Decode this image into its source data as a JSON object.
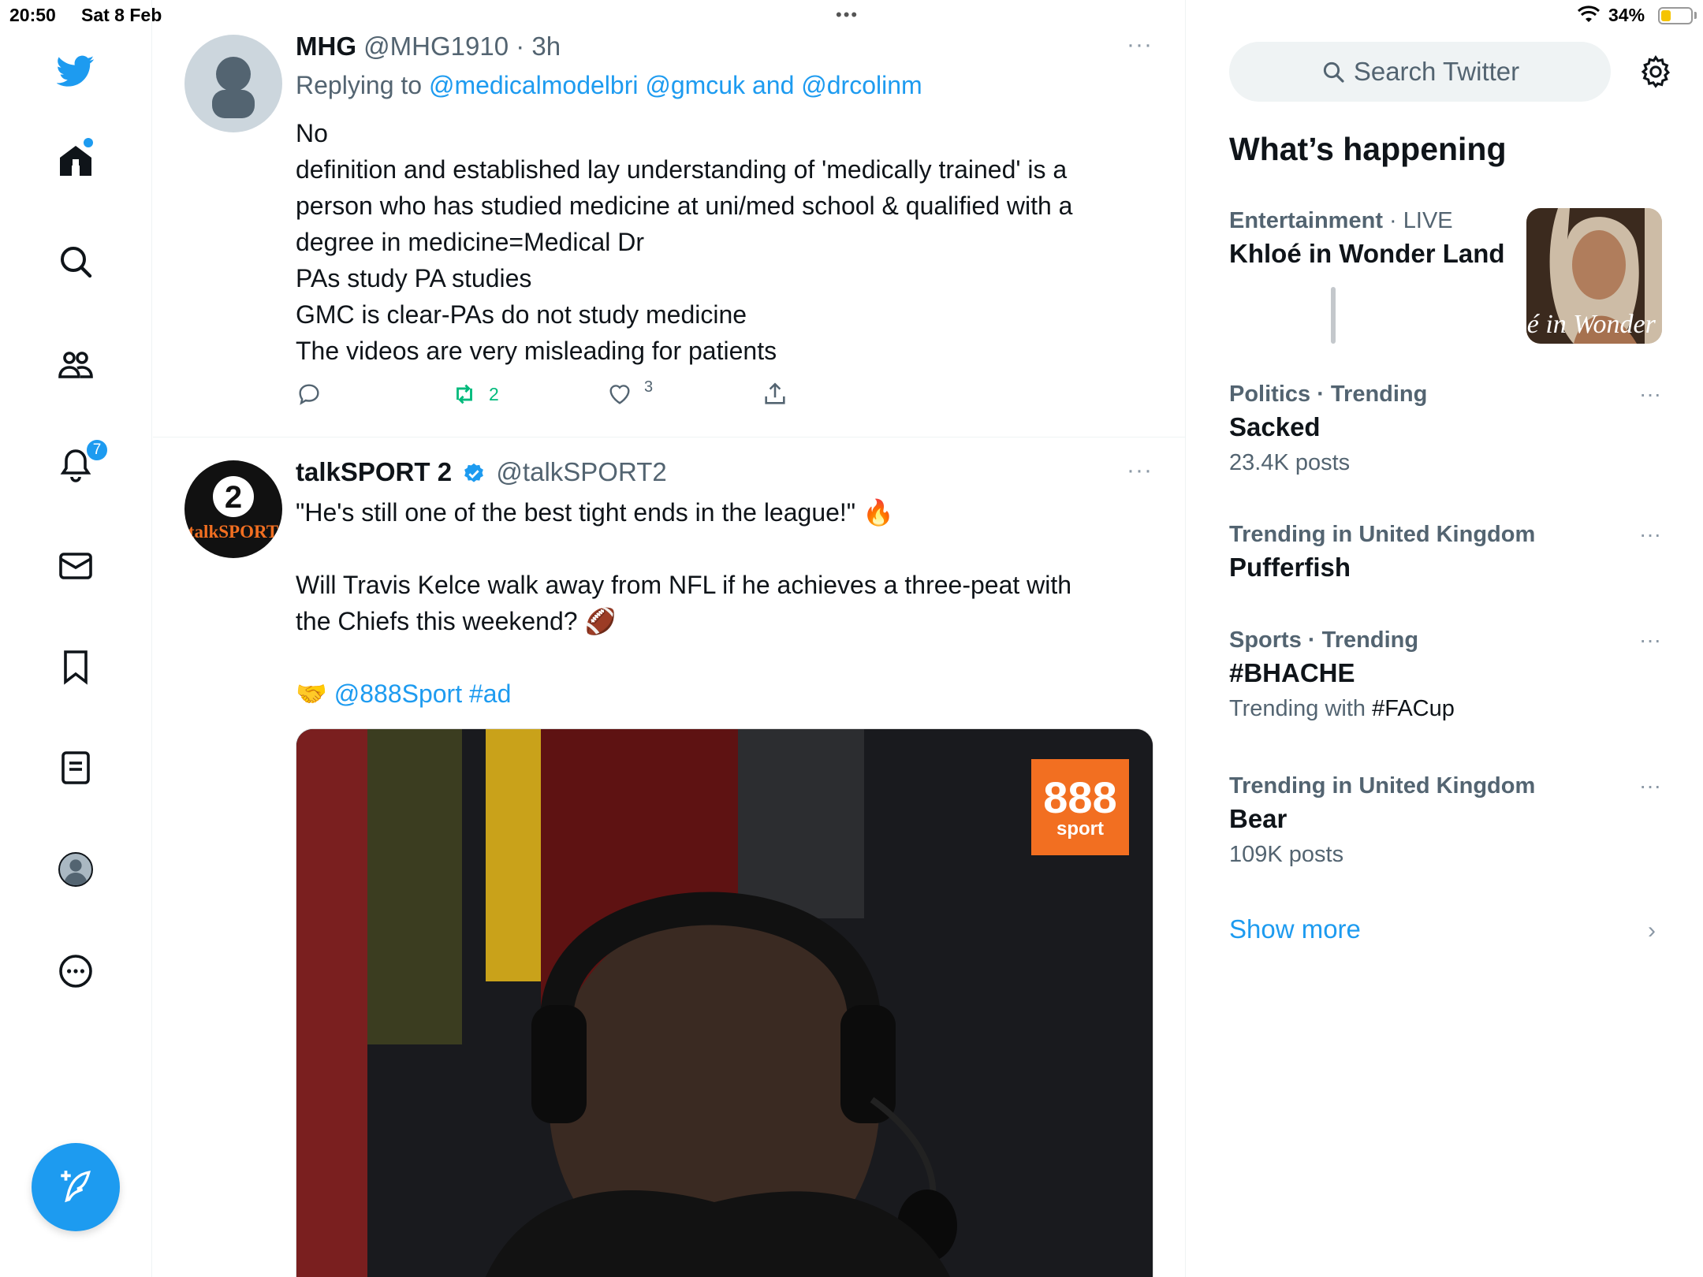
{
  "status_bar": {
    "time": "20:50",
    "date": "Sat 8 Feb",
    "battery": "34%",
    "battery_level": 0.34
  },
  "nav": {
    "notifications_badge": "7",
    "icons": [
      "twitter-bird-icon",
      "home-icon",
      "search-icon",
      "communities-icon",
      "notifications-icon",
      "messages-icon",
      "bookmarks-icon",
      "lists-icon",
      "profile-avatar",
      "more-icon",
      "compose-icon"
    ]
  },
  "tweet1": {
    "name": "MHG",
    "handle": "@MHG1910",
    "time": " · 3h",
    "replying_prefix": "Replying to ",
    "reply_users": "@medicalmodelbri @gmcuk and @drcolinm",
    "lines": [
      "No",
      "definition and established lay understanding of 'medically trained' is a",
      "person who has studied medicine at uni/med school & qualified with a",
      "degree in medicine=Medical Dr",
      "PAs study PA studies",
      "GMC is clear-PAs do not study medicine",
      "The videos are very misleading for patients"
    ],
    "retweets": "2",
    "likes": "3",
    "more": "···"
  },
  "tweet2": {
    "name": "talkSPORT 2",
    "handle": "@talkSPORT2",
    "avatar_text": "talkSPORT",
    "avatar_number": "2",
    "line1": "\"He's still one of the best tight ends in the league!\" 🔥",
    "line2": "Will Travis Kelce walk away from NFL if he achieves a three-peat with",
    "line3": "the Chiefs this weekend? 🏈",
    "handshake": "🤝",
    "links": "@888Sport #ad",
    "media_brand": "888",
    "media_brand_sub": "sport",
    "more": "···"
  },
  "sidebar": {
    "search_placeholder": "Search Twitter",
    "whats_happening": "What’s happening",
    "trends": [
      {
        "category": "Entertainment",
        "qualifier": " · LIVE",
        "name": "Khloé in Wonder Land",
        "image_text": "é in Wonder L"
      },
      {
        "category": "Politics · Trending",
        "name": "Sacked",
        "sub": "23.4K posts"
      },
      {
        "category": "Trending in United Kingdom",
        "name": "Pufferfish"
      },
      {
        "category": "Sports · Trending",
        "name": "#BHACHE",
        "sub_prefix": "Trending with ",
        "sub_emph": "#FACup"
      },
      {
        "category": "Trending in United Kingdom",
        "name": "Bear",
        "sub": "109K posts"
      }
    ],
    "more_glyph": "···",
    "show_more": "Show more",
    "chevron": "›"
  },
  "colors": {
    "accent": "#1d9bf0",
    "retweet_green": "#00ba7c",
    "brand_orange": "#f26f21"
  }
}
